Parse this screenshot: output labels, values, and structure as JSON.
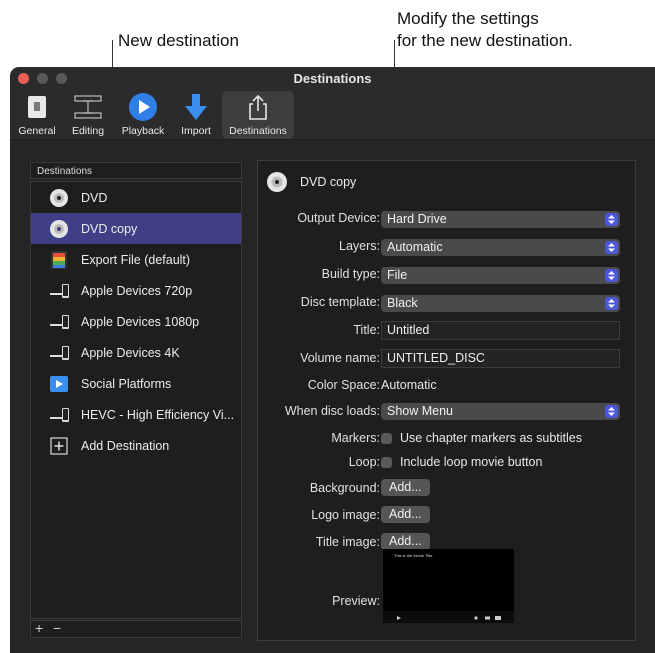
{
  "callouts": {
    "left": "New destination",
    "right": "Modify the settings\nfor the new destination."
  },
  "window": {
    "title": "Destinations"
  },
  "toolbar": [
    {
      "label": "General",
      "icon": "general-switch-icon"
    },
    {
      "label": "Editing",
      "icon": "editing-timeline-icon"
    },
    {
      "label": "Playback",
      "icon": "playback-play-icon"
    },
    {
      "label": "Import",
      "icon": "import-arrow-icon"
    },
    {
      "label": "Destinations",
      "icon": "share-icon",
      "selected": true
    }
  ],
  "list": {
    "header": "Destinations",
    "items": [
      {
        "label": "DVD",
        "icon": "dvd-disc-icon"
      },
      {
        "label": "DVD copy",
        "icon": "dvd-disc-icon",
        "selected": true
      },
      {
        "label": "Export File (default)",
        "icon": "export-file-icon"
      },
      {
        "label": "Apple Devices 720p",
        "icon": "apple-devices-icon"
      },
      {
        "label": "Apple Devices 1080p",
        "icon": "apple-devices-icon"
      },
      {
        "label": "Apple Devices 4K",
        "icon": "apple-devices-icon"
      },
      {
        "label": "Social Platforms",
        "icon": "social-platforms-icon"
      },
      {
        "label": "HEVC - High Efficiency Vi...",
        "icon": "apple-devices-icon"
      },
      {
        "label": "Add Destination",
        "icon": "add-destination-icon"
      }
    ],
    "footer": {
      "add": "+",
      "remove": "−"
    }
  },
  "detail": {
    "title": "DVD copy",
    "output_device": {
      "label": "Output Device:",
      "value": "Hard Drive"
    },
    "layers": {
      "label": "Layers:",
      "value": "Automatic"
    },
    "build_type": {
      "label": "Build type:",
      "value": "File"
    },
    "disc_template": {
      "label": "Disc template:",
      "value": "Black"
    },
    "title_field": {
      "label": "Title:",
      "value": "Untitled"
    },
    "volume_name": {
      "label": "Volume name:",
      "value": "UNTITLED_DISC"
    },
    "color_space": {
      "label": "Color Space:",
      "value": "Automatic"
    },
    "when_disc_loads": {
      "label": "When disc loads:",
      "value": "Show Menu"
    },
    "markers": {
      "label": "Markers:",
      "value": "Use chapter markers as subtitles"
    },
    "loop": {
      "label": "Loop:",
      "value": "Include loop movie button"
    },
    "background": {
      "label": "Background:",
      "button": "Add..."
    },
    "logo_image": {
      "label": "Logo image:",
      "button": "Add..."
    },
    "title_image": {
      "label": "Title image:",
      "button": "Add..."
    },
    "preview": {
      "label": "Preview:",
      "movie_title": "This is the Movie Title"
    }
  },
  "colors": {
    "accent": "#4d58d8",
    "selection": "#3f3f86",
    "window_bg": "#2b2b2d"
  }
}
